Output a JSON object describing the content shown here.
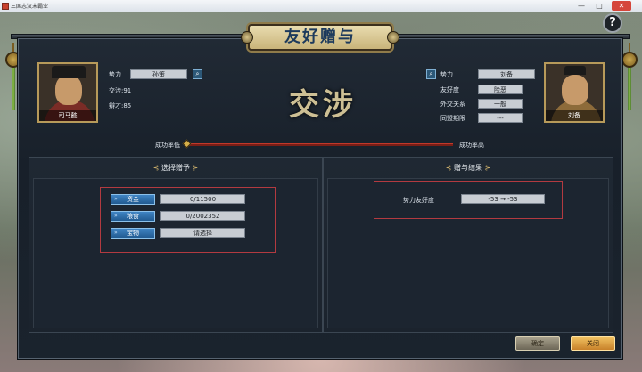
{
  "window": {
    "title": "三国志汉末霸业",
    "minimize": "—",
    "maximize": "□",
    "close": "✕"
  },
  "help": {
    "label": "?"
  },
  "dialog": {
    "title": "友好赠与",
    "center_title": "交涉"
  },
  "left_char": {
    "name": "司马懿",
    "faction_label": "势力",
    "faction_value": "孙策",
    "negotiation": "交涉:91",
    "eloquence": "辩才:85"
  },
  "right_char": {
    "name": "刘备",
    "faction_label": "势力",
    "faction_value": "刘备",
    "friendship_label": "友好度",
    "friendship_value": "险恶",
    "diplomacy_label": "外交关系",
    "diplomacy_value": "一般",
    "alliance_label": "同盟期限",
    "alliance_value": "---"
  },
  "success": {
    "low_label": "成功率低",
    "high_label": "成功率高",
    "level": 0.0
  },
  "gift_panel": {
    "title": "选择赠予",
    "ornament_left": "⊰",
    "ornament_right": "⊱",
    "items": [
      {
        "label": "资金",
        "value": "0/11500"
      },
      {
        "label": "粮食",
        "value": "0/2002352"
      },
      {
        "label": "宝物",
        "value": "请选择"
      }
    ]
  },
  "result_panel": {
    "title": "赠与结果",
    "ornament_left": "⊰",
    "ornament_right": "⊱",
    "row_label": "势力友好度",
    "row_value": "-53 → -53"
  },
  "buttons": {
    "ok": "确定",
    "close": "关闭"
  },
  "colors": {
    "accent_gold": "#cdbf94",
    "button_blue": "#2f6faa",
    "frame_red": "#b33a40",
    "bar_red": "#7a1e16"
  }
}
